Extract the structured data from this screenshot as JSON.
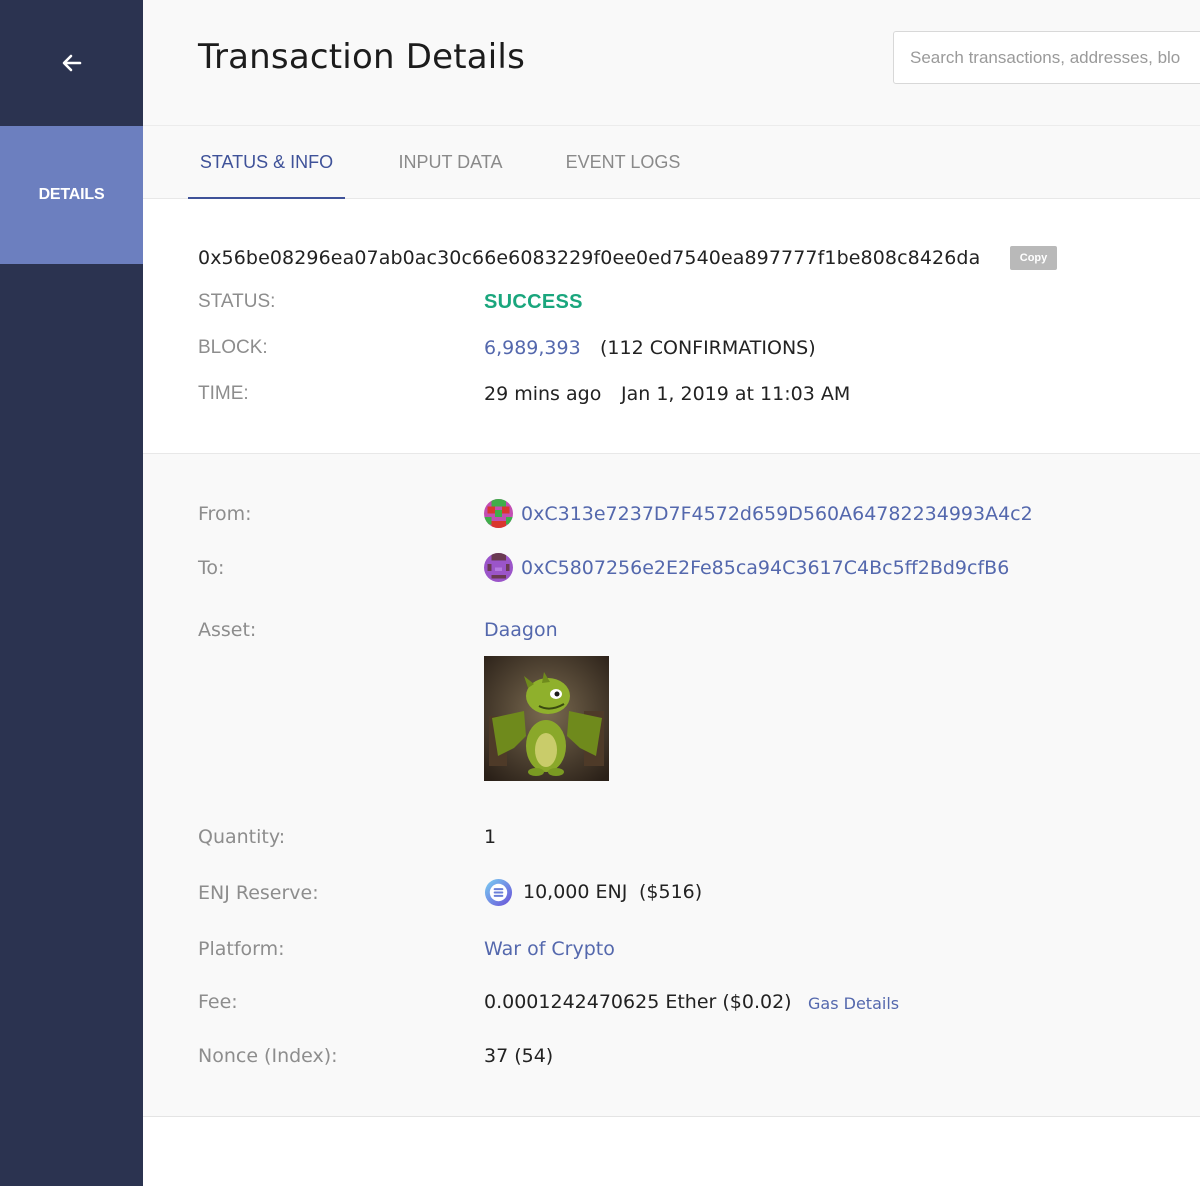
{
  "sidebar": {
    "back_icon": "arrow-left-icon",
    "items": [
      {
        "label": "DETAILS"
      }
    ]
  },
  "header": {
    "title": "Transaction Details",
    "search_placeholder": "Search transactions, addresses, blo"
  },
  "tabs": [
    {
      "label": "STATUS & INFO",
      "active": true
    },
    {
      "label": "INPUT DATA",
      "active": false
    },
    {
      "label": "EVENT LOGS",
      "active": false
    }
  ],
  "info": {
    "hash": "0x56be08296ea07ab0ac30c66e6083229f0ee0ed7540ea897777f1be808c8426da",
    "copy_label": "Copy",
    "status_label": "STATUS:",
    "status_value": "SUCCESS",
    "block_label": "BLOCK:",
    "block_value": "6,989,393",
    "block_confirmations": "(112 CONFIRMATIONS)",
    "time_label": "TIME:",
    "time_relative": "29 mins ago",
    "time_absolute": "Jan 1, 2019 at 11:03 AM"
  },
  "details": {
    "from_label": "From:",
    "from_address": "0xC313e7237D7F4572d659D560A64782234993A4c2",
    "to_label": "To:",
    "to_address": "0xC5807256e2E2Fe85ca94C3617C4Bc5ff2Bd9cfB6",
    "asset_label": "Asset:",
    "asset_name": "Daagon",
    "quantity_label": "Quantity:",
    "quantity_value": "1",
    "reserve_label": "ENJ Reserve:",
    "reserve_value": "10,000 ENJ",
    "reserve_usd": "($516)",
    "platform_label": "Platform:",
    "platform_value": "War of Crypto",
    "fee_label": "Fee:",
    "fee_value": "0.0001242470625 Ether ($0.02)",
    "gas_link": "Gas Details",
    "nonce_label": "Nonce (Index):",
    "nonce_value": "37 (54)"
  },
  "colors": {
    "sidebar_bg": "#2b3350",
    "sidebar_active": "#6c7fbf",
    "accent": "#3f5299",
    "link": "#5468ad",
    "success": "#1aa67d"
  }
}
